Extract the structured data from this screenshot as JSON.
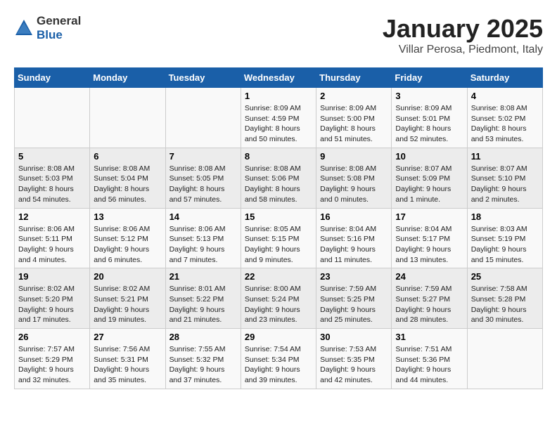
{
  "logo": {
    "general": "General",
    "blue": "Blue"
  },
  "title": "January 2025",
  "subtitle": "Villar Perosa, Piedmont, Italy",
  "days_of_week": [
    "Sunday",
    "Monday",
    "Tuesday",
    "Wednesday",
    "Thursday",
    "Friday",
    "Saturday"
  ],
  "weeks": [
    [
      {
        "day": "",
        "info": ""
      },
      {
        "day": "",
        "info": ""
      },
      {
        "day": "",
        "info": ""
      },
      {
        "day": "1",
        "info": "Sunrise: 8:09 AM\nSunset: 4:59 PM\nDaylight: 8 hours\nand 50 minutes."
      },
      {
        "day": "2",
        "info": "Sunrise: 8:09 AM\nSunset: 5:00 PM\nDaylight: 8 hours\nand 51 minutes."
      },
      {
        "day": "3",
        "info": "Sunrise: 8:09 AM\nSunset: 5:01 PM\nDaylight: 8 hours\nand 52 minutes."
      },
      {
        "day": "4",
        "info": "Sunrise: 8:08 AM\nSunset: 5:02 PM\nDaylight: 8 hours\nand 53 minutes."
      }
    ],
    [
      {
        "day": "5",
        "info": "Sunrise: 8:08 AM\nSunset: 5:03 PM\nDaylight: 8 hours\nand 54 minutes."
      },
      {
        "day": "6",
        "info": "Sunrise: 8:08 AM\nSunset: 5:04 PM\nDaylight: 8 hours\nand 56 minutes."
      },
      {
        "day": "7",
        "info": "Sunrise: 8:08 AM\nSunset: 5:05 PM\nDaylight: 8 hours\nand 57 minutes."
      },
      {
        "day": "8",
        "info": "Sunrise: 8:08 AM\nSunset: 5:06 PM\nDaylight: 8 hours\nand 58 minutes."
      },
      {
        "day": "9",
        "info": "Sunrise: 8:08 AM\nSunset: 5:08 PM\nDaylight: 9 hours\nand 0 minutes."
      },
      {
        "day": "10",
        "info": "Sunrise: 8:07 AM\nSunset: 5:09 PM\nDaylight: 9 hours\nand 1 minute."
      },
      {
        "day": "11",
        "info": "Sunrise: 8:07 AM\nSunset: 5:10 PM\nDaylight: 9 hours\nand 2 minutes."
      }
    ],
    [
      {
        "day": "12",
        "info": "Sunrise: 8:06 AM\nSunset: 5:11 PM\nDaylight: 9 hours\nand 4 minutes."
      },
      {
        "day": "13",
        "info": "Sunrise: 8:06 AM\nSunset: 5:12 PM\nDaylight: 9 hours\nand 6 minutes."
      },
      {
        "day": "14",
        "info": "Sunrise: 8:06 AM\nSunset: 5:13 PM\nDaylight: 9 hours\nand 7 minutes."
      },
      {
        "day": "15",
        "info": "Sunrise: 8:05 AM\nSunset: 5:15 PM\nDaylight: 9 hours\nand 9 minutes."
      },
      {
        "day": "16",
        "info": "Sunrise: 8:04 AM\nSunset: 5:16 PM\nDaylight: 9 hours\nand 11 minutes."
      },
      {
        "day": "17",
        "info": "Sunrise: 8:04 AM\nSunset: 5:17 PM\nDaylight: 9 hours\nand 13 minutes."
      },
      {
        "day": "18",
        "info": "Sunrise: 8:03 AM\nSunset: 5:19 PM\nDaylight: 9 hours\nand 15 minutes."
      }
    ],
    [
      {
        "day": "19",
        "info": "Sunrise: 8:02 AM\nSunset: 5:20 PM\nDaylight: 9 hours\nand 17 minutes."
      },
      {
        "day": "20",
        "info": "Sunrise: 8:02 AM\nSunset: 5:21 PM\nDaylight: 9 hours\nand 19 minutes."
      },
      {
        "day": "21",
        "info": "Sunrise: 8:01 AM\nSunset: 5:22 PM\nDaylight: 9 hours\nand 21 minutes."
      },
      {
        "day": "22",
        "info": "Sunrise: 8:00 AM\nSunset: 5:24 PM\nDaylight: 9 hours\nand 23 minutes."
      },
      {
        "day": "23",
        "info": "Sunrise: 7:59 AM\nSunset: 5:25 PM\nDaylight: 9 hours\nand 25 minutes."
      },
      {
        "day": "24",
        "info": "Sunrise: 7:59 AM\nSunset: 5:27 PM\nDaylight: 9 hours\nand 28 minutes."
      },
      {
        "day": "25",
        "info": "Sunrise: 7:58 AM\nSunset: 5:28 PM\nDaylight: 9 hours\nand 30 minutes."
      }
    ],
    [
      {
        "day": "26",
        "info": "Sunrise: 7:57 AM\nSunset: 5:29 PM\nDaylight: 9 hours\nand 32 minutes."
      },
      {
        "day": "27",
        "info": "Sunrise: 7:56 AM\nSunset: 5:31 PM\nDaylight: 9 hours\nand 35 minutes."
      },
      {
        "day": "28",
        "info": "Sunrise: 7:55 AM\nSunset: 5:32 PM\nDaylight: 9 hours\nand 37 minutes."
      },
      {
        "day": "29",
        "info": "Sunrise: 7:54 AM\nSunset: 5:34 PM\nDaylight: 9 hours\nand 39 minutes."
      },
      {
        "day": "30",
        "info": "Sunrise: 7:53 AM\nSunset: 5:35 PM\nDaylight: 9 hours\nand 42 minutes."
      },
      {
        "day": "31",
        "info": "Sunrise: 7:51 AM\nSunset: 5:36 PM\nDaylight: 9 hours\nand 44 minutes."
      },
      {
        "day": "",
        "info": ""
      }
    ]
  ]
}
